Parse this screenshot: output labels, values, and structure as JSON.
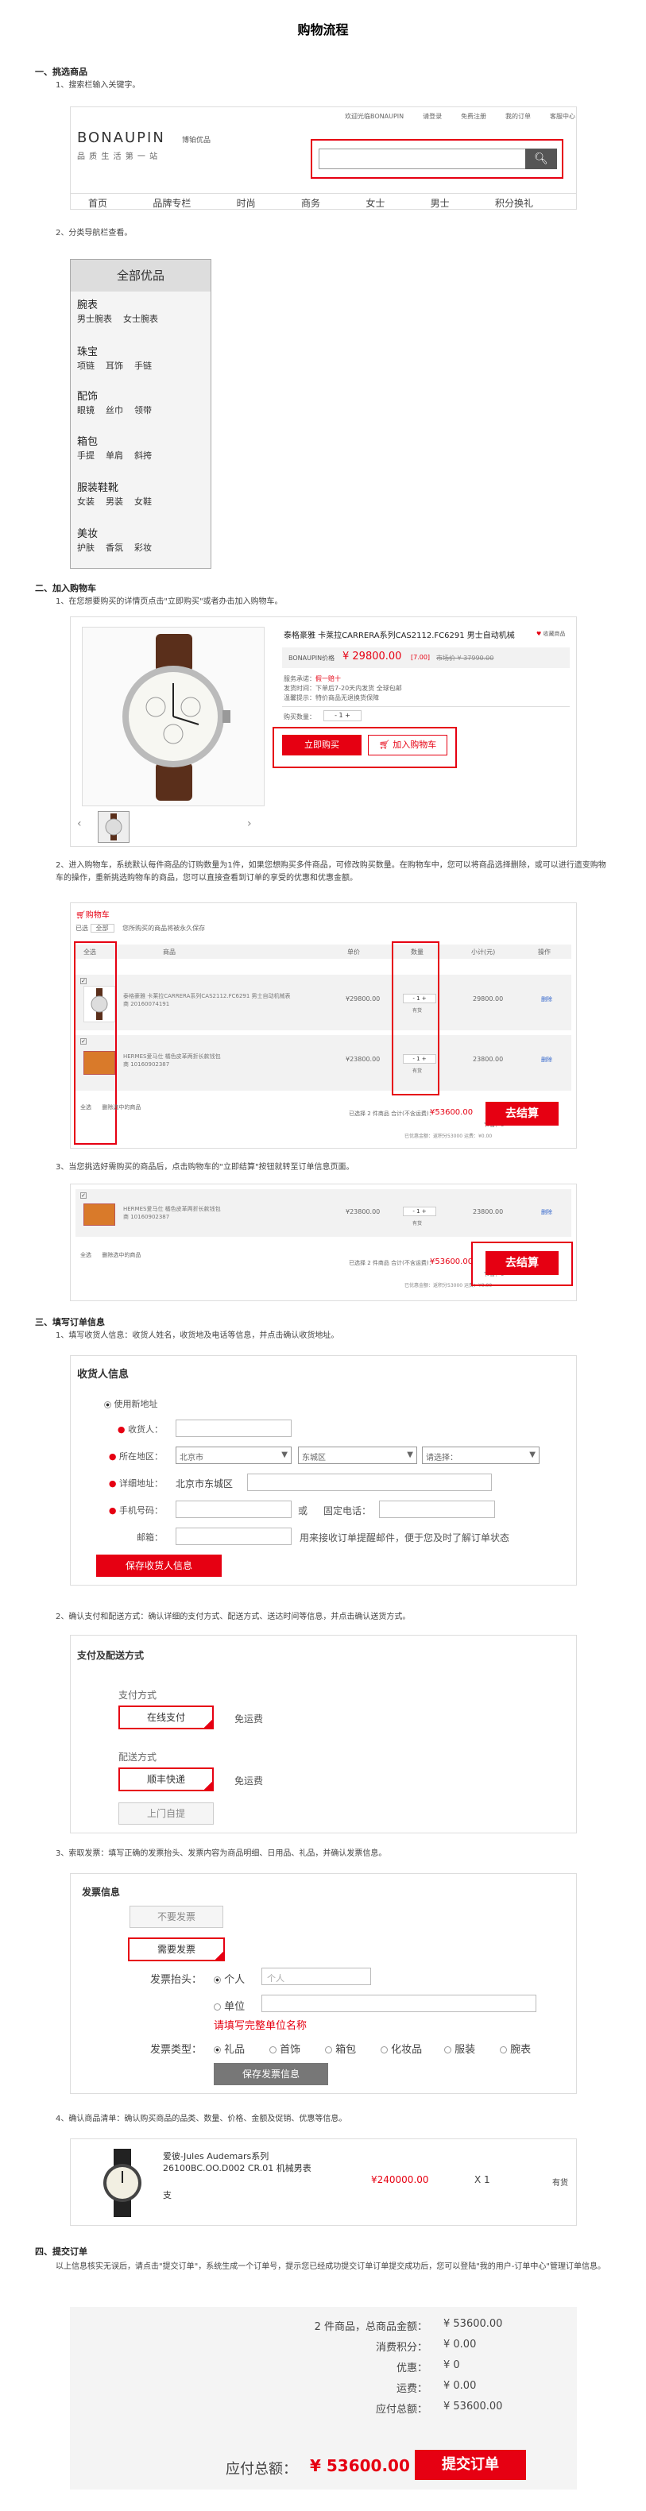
{
  "page_title": "购物流程",
  "sec1": {
    "heading": "一、挑选商品",
    "step1": "1、搜索栏输入关键字。",
    "step2": "2、分类导航栏查看。"
  },
  "site": {
    "top_links": [
      "欢迎光临BONAUPIN",
      "请登录",
      "免费注册",
      "我的订单",
      "客服中心"
    ],
    "logo": "BONAUPIN",
    "logo_cn": "博铂优品",
    "slogan": "品 质 生 活 第 一 站",
    "search_placeholder": "",
    "nav": [
      "首页",
      "品牌专栏",
      "时尚",
      "商务",
      "女士",
      "男士",
      "积分换礼"
    ]
  },
  "category": {
    "header": "全部优品",
    "groups": [
      {
        "title": "腕表",
        "subs": "男士腕表    女士腕表"
      },
      {
        "title": "珠宝",
        "subs": "项链    耳饰    手链"
      },
      {
        "title": "配饰",
        "subs": "眼镜    丝巾    领带"
      },
      {
        "title": "箱包",
        "subs": "手提    单肩    斜挎"
      },
      {
        "title": "服装鞋靴",
        "subs": "女装    男装    女鞋"
      },
      {
        "title": "美妆",
        "subs": "护肤    香氛    彩妆"
      }
    ]
  },
  "sec2": {
    "heading": "二、加入购物车",
    "step1": "1、在您想要购买的详情页点击\"立即购买\"或者办击加入购物车。",
    "step2": "2、进入购物车，系统默认每件商品的订购数量为1件，如果您想购买多件商品，可修改购买数量。在购物车中，您可以将商品选择删除，或可以进行遗变购物车的操作，重新挑选购物车的商品，您可以直接查看到订单的享受的优惠和优惠金额。",
    "step3": "3、当您挑选好需购买的商品后，点击购物车的\"立即结算\"按钮就转至订单信息页面。"
  },
  "product": {
    "name": "泰格豪雅 卡莱拉CARRERA系列CAS2112.FC6291 男士自动机械",
    "fav": "收藏商品",
    "price_label": "BONAUPIN价格",
    "price": "¥ 29800.00",
    "discount": "[7.00]",
    "market_price": "市场价 ¥ 37990.00",
    "service_label": "服务承诺：",
    "service_val": "假一赔十",
    "ship_label": "发货时间：",
    "ship_val": "下单后7-20天内发货 全球包邮",
    "note_label": "温馨提示：",
    "note_val": "特价商品无退换货保障",
    "qty_label": "购买数量：",
    "qty": "1",
    "buy_now": "立即购买",
    "add_cart": "加入购物车"
  },
  "cart": {
    "title": "购物车",
    "filter_all": "全部",
    "filter_label": "已选",
    "tip": "您所购买的商品将被永久保存",
    "headers": [
      "全选",
      "商品",
      "单价",
      "数量",
      "小计(元)",
      "操作"
    ],
    "rows": [
      {
        "name": "泰格豪雅 卡莱拉CARRERA系列CAS2112.FC6291 男士自动机械表",
        "code": "商 20160074191",
        "price": "¥29800.00",
        "qty": "1",
        "stock": "有货",
        "subtotal": "29800.00",
        "op": "删除"
      },
      {
        "name": "HERMES爱马仕 橘色皮革两折长款钱包",
        "code": "商 10160902387",
        "price": "¥23800.00",
        "qty": "1",
        "stock": "有货",
        "subtotal": "23800.00",
        "op": "删除"
      }
    ],
    "footer_left": "全选      删除选中的商品",
    "selected": "已选择 2 件商品  合计(不含运费)：",
    "total": "¥53600.00",
    "saved": "节省：0",
    "extra": "已优惠金额：返积分53000  运费：¥0.00",
    "checkout": "去结算"
  },
  "sec3": {
    "heading": "三、填写订单信息",
    "step1": "1、填写收货人信息：收货人姓名，收货地及电话等信息，并点击确认收货地址。",
    "step2": "2、确认支付和配送方式：确认详细的支付方式、配送方式、送达时间等信息，并点击确认送货方式。",
    "step3": "3、索取发票：填写正确的发票抬头、发票内容为商品明细、日用品、礼品，并确认发票信息。",
    "step4": "4、确认商品清单：确认购买商品的品类、数量、价格、金额及促销、优惠等信息。"
  },
  "address": {
    "title": "收货人信息",
    "use_new": "使用新地址",
    "receiver": "收货人：",
    "region": "所在地区：",
    "region_vals": [
      "北京市",
      "东城区",
      "请选择："
    ],
    "detail": "详细地址：",
    "detail_prefix": "北京市东城区",
    "mobile": "手机号码：",
    "or": "或",
    "phone": "固定电话：",
    "email": "邮箱：",
    "email_hint": "用来接收订单提醒邮件，便于您及时了解订单状态",
    "save": "保存收货人信息"
  },
  "payment": {
    "title": "支付及配送方式",
    "pay_label": "支付方式",
    "pay_opt": "在线支付",
    "pay_note": "免运费",
    "ship_label": "配送方式",
    "ship_opt1": "顺丰快递",
    "ship_note": "免运费",
    "ship_opt2": "上门自提"
  },
  "invoice": {
    "title": "发票信息",
    "no_invoice": "不要发票",
    "need_invoice": "需要发票",
    "head_label": "发票抬头：",
    "personal": "个人",
    "personal_placeholder": "个人",
    "company": "单位",
    "company_hint": "请填写完整单位名称",
    "type_label": "发票类型：",
    "types": [
      "礼品",
      "首饰",
      "箱包",
      "化妆品",
      "服装",
      "腕表"
    ],
    "save": "保存发票信息"
  },
  "item": {
    "name": "爱彼-Jules Audemars系列 26100BC.OO.D002 CR.01 机械男表",
    "sub": "支",
    "price": "¥240000.00",
    "qty": "X 1",
    "stock": "有货"
  },
  "sec4": {
    "heading": "四、提交订单",
    "text": "以上信息核实无误后，请点击\"提交订单\"，系统生成一个订单号，提示您已经成功提交订单订单提交成功后，您可以登陆\"我的用户-订单中心\"管理订单信息。"
  },
  "summary": {
    "rows": [
      {
        "label": "2 件商品，总商品金额：",
        "value": "¥ 53600.00"
      },
      {
        "label": "消费积分：",
        "value": "¥ 0.00"
      },
      {
        "label": "优惠：",
        "value": "¥ 0"
      },
      {
        "label": "运费：",
        "value": "¥ 0.00"
      },
      {
        "label": "应付总额：",
        "value": "¥ 53600.00"
      }
    ],
    "total_label": "应付总额：",
    "total": "¥ 53600.00",
    "submit": "提交订单"
  },
  "colors": {
    "accent": "#e60012",
    "grey_bg": "#f2f2f2"
  }
}
